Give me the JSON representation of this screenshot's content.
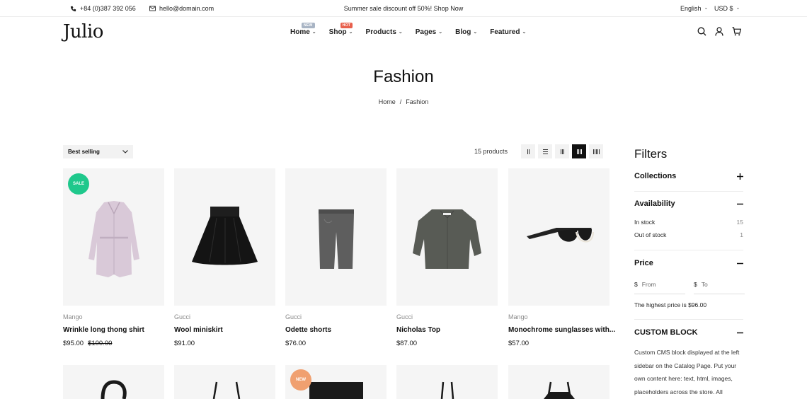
{
  "topbar": {
    "phone": "+84 (0)387 392 056",
    "email": "hello@domain.com",
    "promo": "Summer sale discount off 50%! Shop Now",
    "language": "English",
    "currency": "USD $"
  },
  "header": {
    "logo": "Julio",
    "nav": [
      {
        "label": "Home",
        "badge": "NEW",
        "badge_color": "#a8b4c4"
      },
      {
        "label": "Shop",
        "badge": "HOT",
        "badge_color": "#e8604c"
      },
      {
        "label": "Products"
      },
      {
        "label": "Pages"
      },
      {
        "label": "Blog"
      },
      {
        "label": "Featured"
      }
    ],
    "icons": [
      "search-icon",
      "user-icon",
      "cart-icon"
    ]
  },
  "page": {
    "title": "Fashion",
    "breadcrumb": {
      "home": "Home",
      "separator": "/",
      "current": "Fashion"
    }
  },
  "toolbar": {
    "sort_label": "Best selling",
    "count": "15 products",
    "views": [
      "2-columns",
      "list",
      "3-columns",
      "4-columns",
      "5-columns"
    ],
    "active_view": "4-columns"
  },
  "products": [
    {
      "brand": "Mango",
      "name": "Wrinkle long thong shirt",
      "price": "$95.00",
      "old_price": "$100.00",
      "badge": "SALE",
      "badge_color": "#1fc88c"
    },
    {
      "brand": "Gucci",
      "name": "Wool miniskirt",
      "price": "$91.00"
    },
    {
      "brand": "Gucci",
      "name": "Odette shorts",
      "price": "$76.00"
    },
    {
      "brand": "Gucci",
      "name": "Nicholas Top",
      "price": "$87.00"
    },
    {
      "brand": "Mango",
      "name": "Monochrome sunglasses with...",
      "price": "$57.00"
    }
  ],
  "second_row_badge": {
    "label": "NEW",
    "color": "#f0a070"
  },
  "filters": {
    "title": "Filters",
    "collections": "Collections",
    "availability": {
      "title": "Availability",
      "options": [
        {
          "label": "In stock",
          "count": "15"
        },
        {
          "label": "Out of stock",
          "count": "1"
        }
      ]
    },
    "price": {
      "title": "Price",
      "currency_symbol": "$",
      "from_placeholder": "From",
      "to_placeholder": "To",
      "highest": "The highest price is $96.00"
    },
    "custom_block": {
      "title": "CUSTOM BLOCK",
      "text": "Custom CMS block displayed at the left sidebar on the Catalog Page. Put your own content here: text, html, images, placeholders across the store. All"
    }
  }
}
